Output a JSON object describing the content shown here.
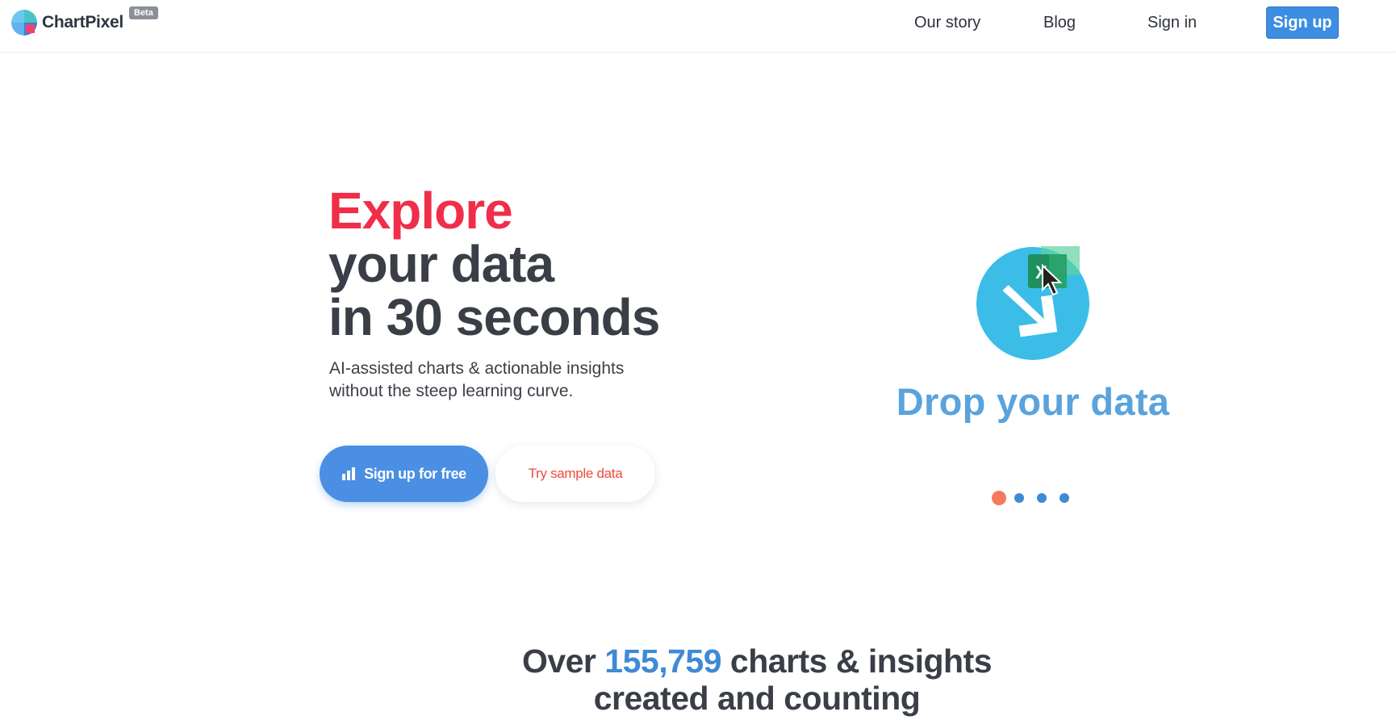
{
  "brand": {
    "name": "ChartPixel",
    "badge": "Beta"
  },
  "nav": {
    "links": [
      "Our story",
      "Blog",
      "Sign in"
    ],
    "signup_label": "Sign up"
  },
  "hero": {
    "title_accent": "Explore",
    "title_line2": "your data",
    "title_line3": "in 30 seconds",
    "subtitle_line1": "AI-assisted charts & actionable insights",
    "subtitle_line2": "without the steep learning curve.",
    "primary_button": "Sign up for free",
    "secondary_button": "Try sample data"
  },
  "carousel": {
    "slide_caption": "Drop your data",
    "slide_count": 4,
    "active_slide": 1,
    "icon": "drop-excel-file-icon",
    "excel_letter": "X"
  },
  "stats": {
    "prefix": "Over",
    "count": "155,759",
    "suffix": "charts & insights",
    "line2": "created and counting"
  },
  "colors": {
    "accent_red": "#ef2f4a",
    "primary_blue": "#3d8de2",
    "drop_blue": "#5aa3dc",
    "icon_cyan": "#3bbde8",
    "dot_active": "#f57a5a"
  }
}
